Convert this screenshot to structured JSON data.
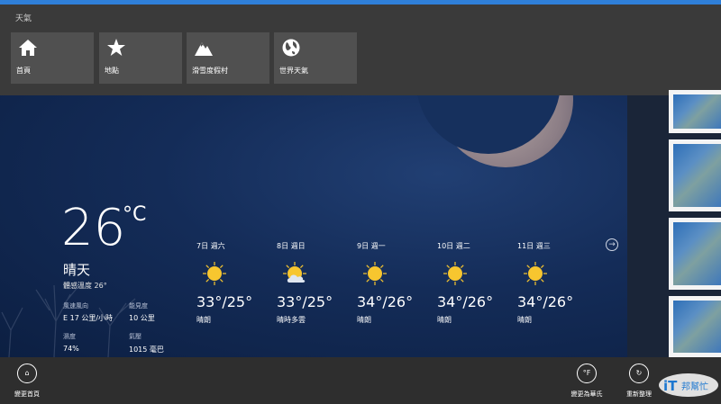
{
  "app": {
    "title": "天氣"
  },
  "nav": {
    "tiles": [
      {
        "label": "首頁",
        "icon": "home-icon"
      },
      {
        "label": "地點",
        "icon": "star-icon"
      },
      {
        "label": "滑雪度假村",
        "icon": "mountain-icon"
      },
      {
        "label": "世界天氣",
        "icon": "globe-icon"
      }
    ]
  },
  "current": {
    "temp": "26",
    "unit": "°C",
    "condition": "晴天",
    "feels_like": "體感溫度 26°",
    "wind_label": "風速風向",
    "wind_value": "E 17 公里/小時",
    "visibility_label": "能見度",
    "visibility_value": "10 公里",
    "humidity_label": "濕度",
    "humidity_value": "74%",
    "pressure_label": "氣壓",
    "pressure_value": "1015 毫巴"
  },
  "forecast": [
    {
      "day": "7日 週六",
      "temps": "33°/25°",
      "desc": "晴朗",
      "icon": "sun-icon"
    },
    {
      "day": "8日 週日",
      "temps": "33°/25°",
      "desc": "晴時多雲",
      "icon": "sun-cloud-icon"
    },
    {
      "day": "9日 週一",
      "temps": "34°/26°",
      "desc": "晴朗",
      "icon": "sun-icon"
    },
    {
      "day": "10日 週二",
      "temps": "34°/26°",
      "desc": "晴朗",
      "icon": "sun-icon"
    },
    {
      "day": "11日 週三",
      "temps": "34°/26°",
      "desc": "晴朗",
      "icon": "sun-icon"
    }
  ],
  "appbar": {
    "set_home": "變更首頁",
    "fahrenheit_symbol": "°F",
    "fahrenheit": "變更為華氏",
    "refresh": "重新整理"
  },
  "watermark": "iT邦幫忙",
  "colors": {
    "accent": "#2f7fd8",
    "nav_bg": "#3a3a3a",
    "tile_bg": "#505050",
    "sun": "#f7c62f"
  }
}
